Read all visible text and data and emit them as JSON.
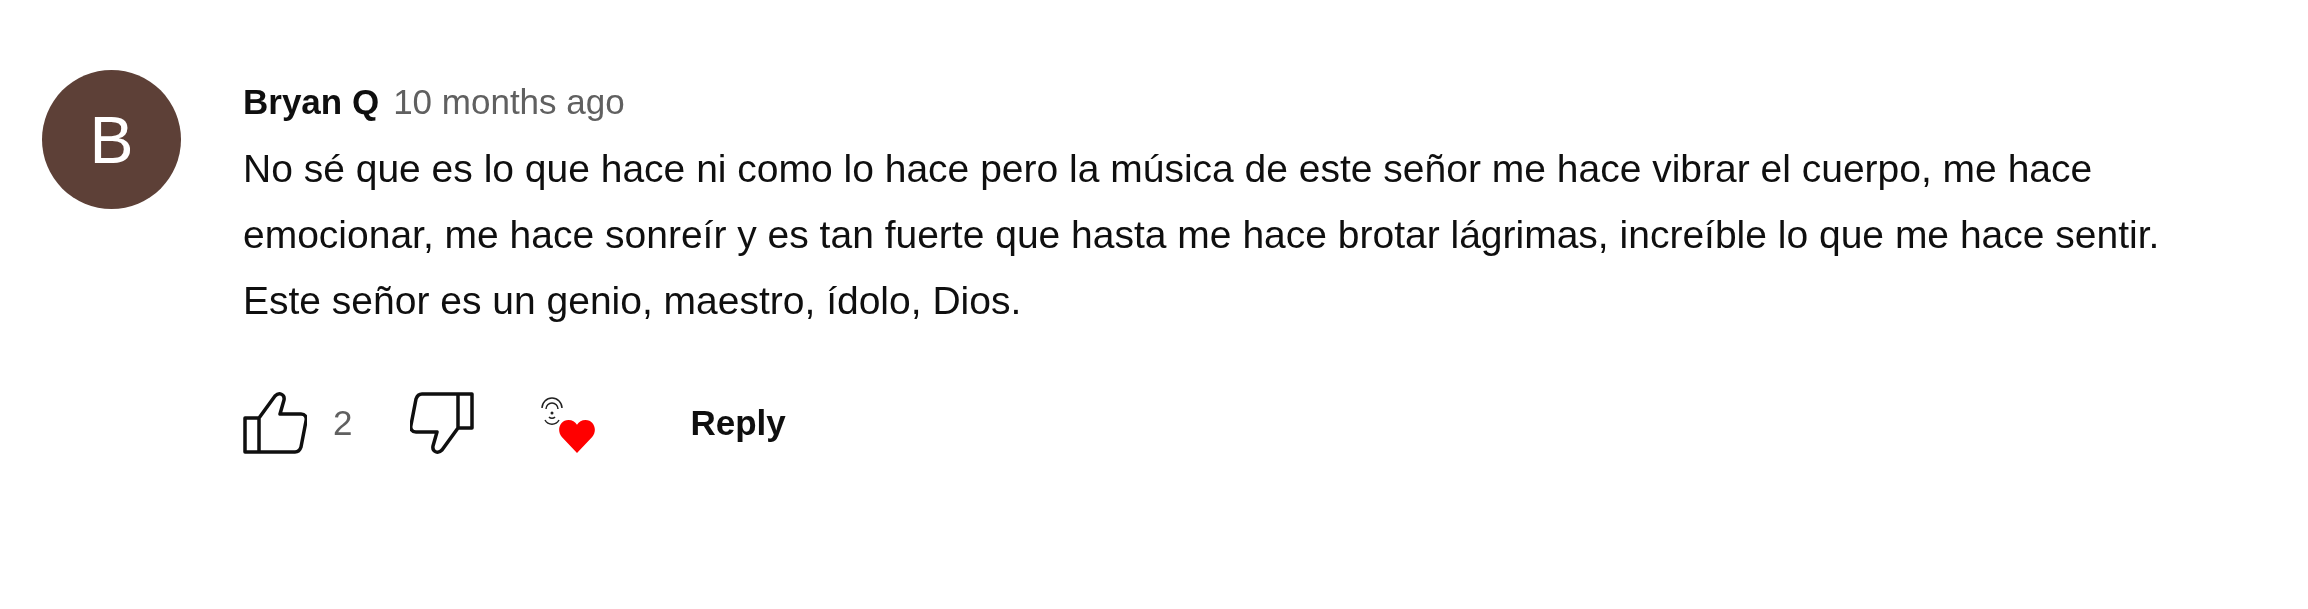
{
  "comment": {
    "avatar_letter": "B",
    "author": "Bryan Q",
    "time": "10 months ago",
    "text": "No sé que es lo que hace ni como lo hace pero la música de este señor me hace vibrar el cuerpo, me hace emocionar, me hace sonreír y es tan fuerte que hasta me hace brotar lágrimas, increíble lo que me hace sentir. Este señor es un genio, maestro, ídolo, Dios.",
    "like_count": "2",
    "creator_heart": true,
    "reply_label": "Reply"
  }
}
